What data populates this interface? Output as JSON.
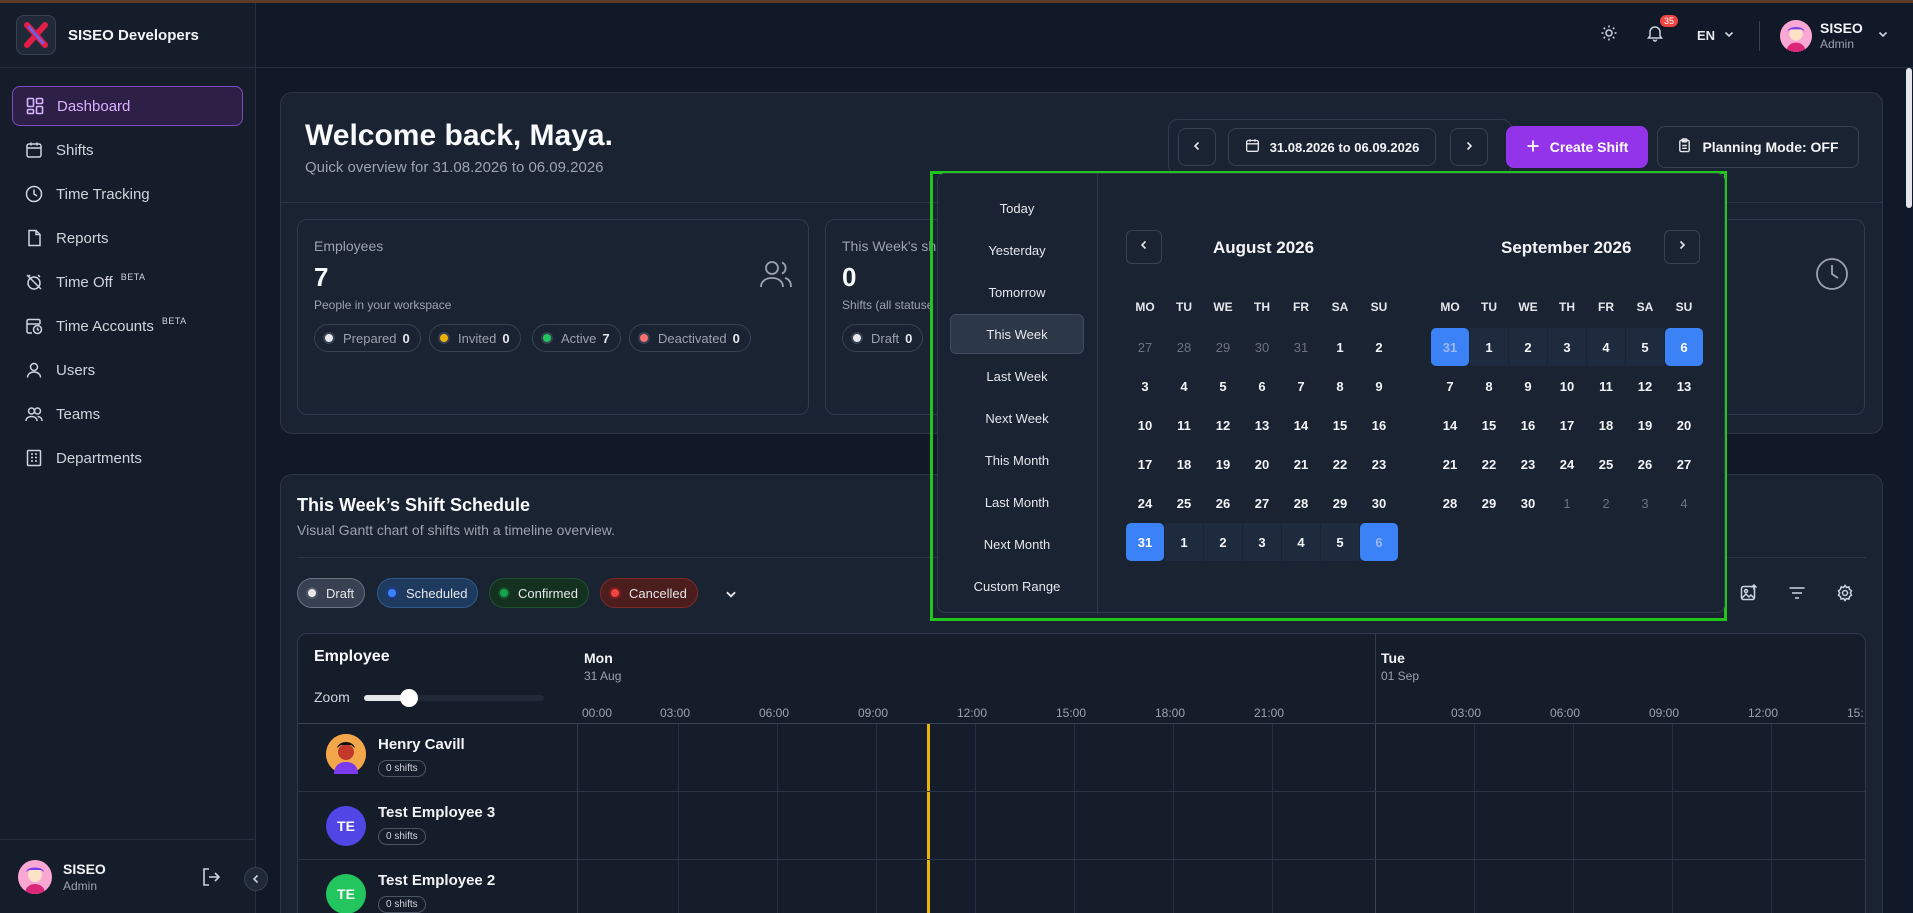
{
  "app": {
    "name": "SISEO Developers"
  },
  "sidebar": {
    "items": [
      {
        "label": "Dashboard",
        "icon": "dashboard-icon"
      },
      {
        "label": "Shifts",
        "icon": "calendar-icon"
      },
      {
        "label": "Time Tracking",
        "icon": "clock-icon"
      },
      {
        "label": "Reports",
        "icon": "file-icon"
      },
      {
        "label": "Time Off",
        "icon": "alarm-off-icon",
        "tag": "BETA"
      },
      {
        "label": "Time Accounts",
        "icon": "calendar-clock-icon",
        "tag": "BETA"
      },
      {
        "label": "Users",
        "icon": "user-icon"
      },
      {
        "label": "Teams",
        "icon": "users-icon"
      },
      {
        "label": "Departments",
        "icon": "building-icon"
      }
    ],
    "user": {
      "name": "SISEO",
      "role": "Admin"
    }
  },
  "topbar": {
    "notifications_count": "35",
    "language": "EN",
    "user": {
      "name": "SISEO",
      "role": "Admin"
    }
  },
  "welcome": {
    "title": "Welcome back, Maya.",
    "subtitle": "Quick overview for 31.08.2026 to 06.09.2026",
    "date_range": "31.08.2026 to 06.09.2026",
    "create_button": "Create Shift",
    "planning_button": "Planning Mode: OFF"
  },
  "stats": {
    "employees": {
      "title": "Employees",
      "value": "7",
      "desc": "People in your workspace",
      "pills": [
        {
          "label": "Prepared",
          "count": "0",
          "color": "#e5e7eb"
        },
        {
          "label": "Invited",
          "count": "0",
          "color": "#eab308"
        },
        {
          "label": "Active",
          "count": "7",
          "color": "#22c55e"
        },
        {
          "label": "Deactivated",
          "count": "0",
          "color": "#f87171"
        }
      ]
    },
    "week_shifts": {
      "title": "This Week's sh",
      "value": "0",
      "desc": "Shifts (all statuse",
      "pill": {
        "label": "Draft",
        "count": "0"
      }
    }
  },
  "schedule": {
    "title": "This Week’s Shift Schedule",
    "subtitle": "Visual Gantt chart of shifts with a timeline overview.",
    "filters": [
      {
        "label": "Draft",
        "color": "#e5e7eb",
        "bg": "#374151"
      },
      {
        "label": "Scheduled",
        "color": "#3b82f6",
        "bg": "#1e3a5f"
      },
      {
        "label": "Confirmed",
        "color": "#16a34a",
        "bg": "#14301f"
      },
      {
        "label": "Cancelled",
        "color": "#ef4444",
        "bg": "#4c1d1d"
      }
    ],
    "employee_header": "Employee",
    "zoom_label": "Zoom",
    "zoom_level": 0.25,
    "days": [
      {
        "name": "Mon",
        "date": "31 Aug"
      },
      {
        "name": "Tue",
        "date": "01 Sep"
      }
    ],
    "hours_day1": [
      "00:00",
      "03:00",
      "06:00",
      "09:00",
      "12:00",
      "15:00",
      "18:00",
      "21:00"
    ],
    "hours_day2": [
      "03:00",
      "06:00",
      "09:00",
      "12:00",
      "15:"
    ],
    "employees": [
      {
        "name": "Henry Cavill",
        "shifts": "0 shifts",
        "initials": "",
        "color": "#f59e0b"
      },
      {
        "name": "Test Employee 3",
        "shifts": "0 shifts",
        "initials": "TE",
        "color": "#4f46e5"
      },
      {
        "name": "Test Employee 2",
        "shifts": "0 shifts",
        "initials": "TE",
        "color": "#22c55e"
      }
    ]
  },
  "datepicker": {
    "presets": [
      "Today",
      "Yesterday",
      "Tomorrow",
      "This Week",
      "Last Week",
      "Next Week",
      "This Month",
      "Last Month",
      "Next Month",
      "Custom Range"
    ],
    "selected_preset": "This Week",
    "weekdays": [
      "MO",
      "TU",
      "WE",
      "TH",
      "FR",
      "SA",
      "SU"
    ],
    "months": [
      {
        "title": "August 2026",
        "weeks": [
          [
            "27",
            "28",
            "29",
            "30",
            "31",
            "1",
            "2"
          ],
          [
            "3",
            "4",
            "5",
            "6",
            "7",
            "8",
            "9"
          ],
          [
            "10",
            "11",
            "12",
            "13",
            "14",
            "15",
            "16"
          ],
          [
            "17",
            "18",
            "19",
            "20",
            "21",
            "22",
            "23"
          ],
          [
            "24",
            "25",
            "26",
            "27",
            "28",
            "29",
            "30"
          ],
          [
            "31",
            "1",
            "2",
            "3",
            "4",
            "5",
            "6"
          ]
        ]
      },
      {
        "title": "September 2026",
        "weeks": [
          [
            "31",
            "1",
            "2",
            "3",
            "4",
            "5",
            "6"
          ],
          [
            "7",
            "8",
            "9",
            "10",
            "11",
            "12",
            "13"
          ],
          [
            "14",
            "15",
            "16",
            "17",
            "18",
            "19",
            "20"
          ],
          [
            "21",
            "22",
            "23",
            "24",
            "25",
            "26",
            "27"
          ],
          [
            "28",
            "29",
            "30",
            "1",
            "2",
            "3",
            "4"
          ]
        ]
      }
    ]
  }
}
